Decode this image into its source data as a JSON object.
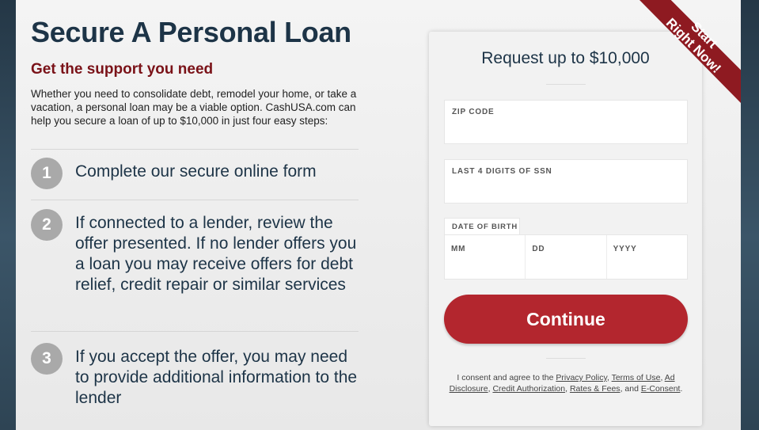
{
  "page": {
    "title": "Secure A Personal Loan",
    "subtitle": "Get the support you need",
    "intro": "Whether you need to consolidate debt, remodel your home, or take a vacation, a personal loan may be a viable option. CashUSA.com can help you secure a loan of up to $10,000 in just four easy steps:"
  },
  "steps": [
    {
      "number": "1",
      "text": "Complete our secure online form"
    },
    {
      "number": "2",
      "text": "If connected to a lender, review the offer presented. If no lender offers you a loan you may receive offers for debt relief, credit repair or similar services"
    },
    {
      "number": "3",
      "text": "If you accept the offer, you may need to provide additional information to the lender"
    }
  ],
  "form": {
    "title": "Request up to $10,000",
    "zip_label": "ZIP CODE",
    "zip_value": "",
    "ssn_label": "LAST 4 DIGITS OF SSN",
    "ssn_value": "",
    "dob_label": "DATE OF BIRTH",
    "dob_mm_placeholder": "MM",
    "dob_dd_placeholder": "DD",
    "dob_yyyy_placeholder": "YYYY",
    "continue_label": "Continue",
    "consent_prefix": "I consent and agree to the",
    "consent_and": "and",
    "links": {
      "privacy": "Privacy Policy",
      "terms": "Terms of Use",
      "ad": "Ad Disclosure",
      "credit": "Credit Authorization",
      "rates": "Rates & Fees",
      "econsent": "E-Consent"
    }
  },
  "ribbon": {
    "line1": "Start",
    "line2": "Right Now!"
  },
  "colors": {
    "brand_navy": "#1d3447",
    "subtitle_red": "#7a1218",
    "button_red": "#b3262e",
    "ribbon_red": "#8e1a21"
  }
}
